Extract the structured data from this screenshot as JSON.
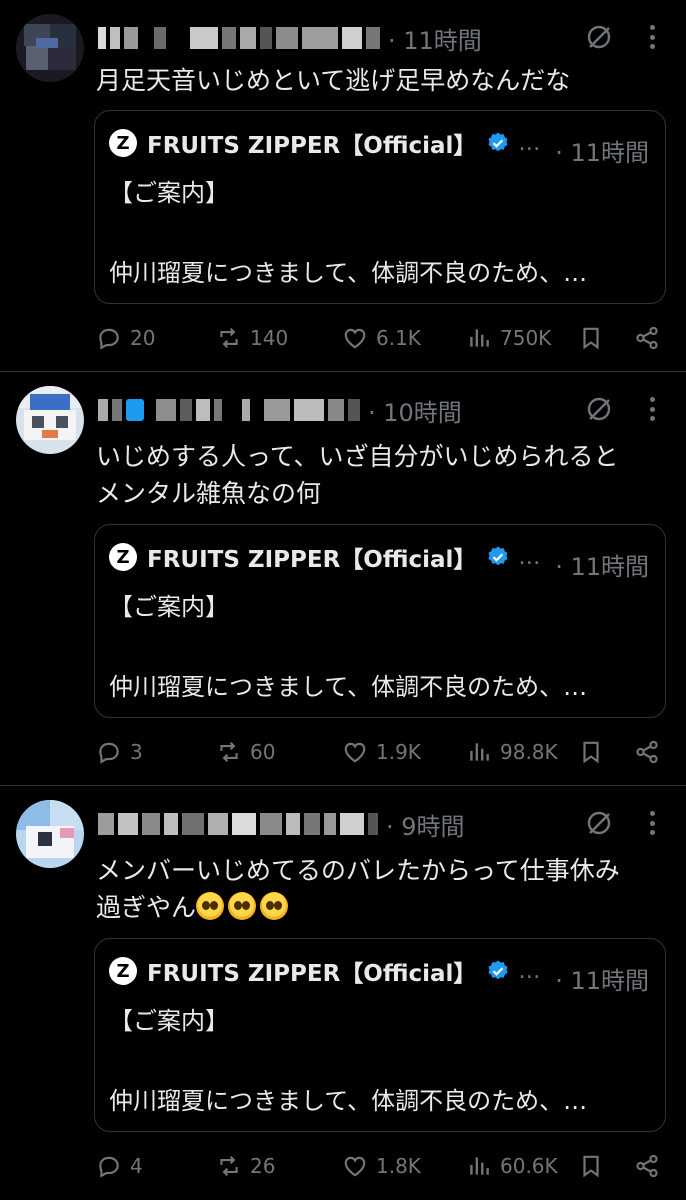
{
  "colors": {
    "background": "#000000",
    "text": "#e7e9ea",
    "muted": "#71767b",
    "border": "#2f3336",
    "verified": "#1d9bf0"
  },
  "quote_template": {
    "account_name": "FRUITS ZIPPER【Official】",
    "ellipsis": "…",
    "time": "· 11時間",
    "line1": "【ご案内】",
    "line2": "仲川瑠夏につきまして、体調不良のため、…"
  },
  "posts": [
    {
      "time": "· 11時間",
      "text_lines": [
        "月足天音いじめといて逃げ足早めなんだな"
      ],
      "replies": "20",
      "reposts": "140",
      "likes": "6.1K",
      "views": "750K"
    },
    {
      "time": "· 10時間",
      "text_lines": [
        "いじめする人って、いざ自分がいじめられると",
        "メンタル雑魚なの何"
      ],
      "replies": "3",
      "reposts": "60",
      "likes": "1.9K",
      "views": "98.8K"
    },
    {
      "time": "· 9時間",
      "text_lines": [
        "メンバーいじめてるのバレたからって仕事休み",
        "過ぎやん"
      ],
      "emoji_count": 3,
      "replies": "4",
      "reposts": "26",
      "likes": "1.8K",
      "views": "60.6K"
    }
  ]
}
